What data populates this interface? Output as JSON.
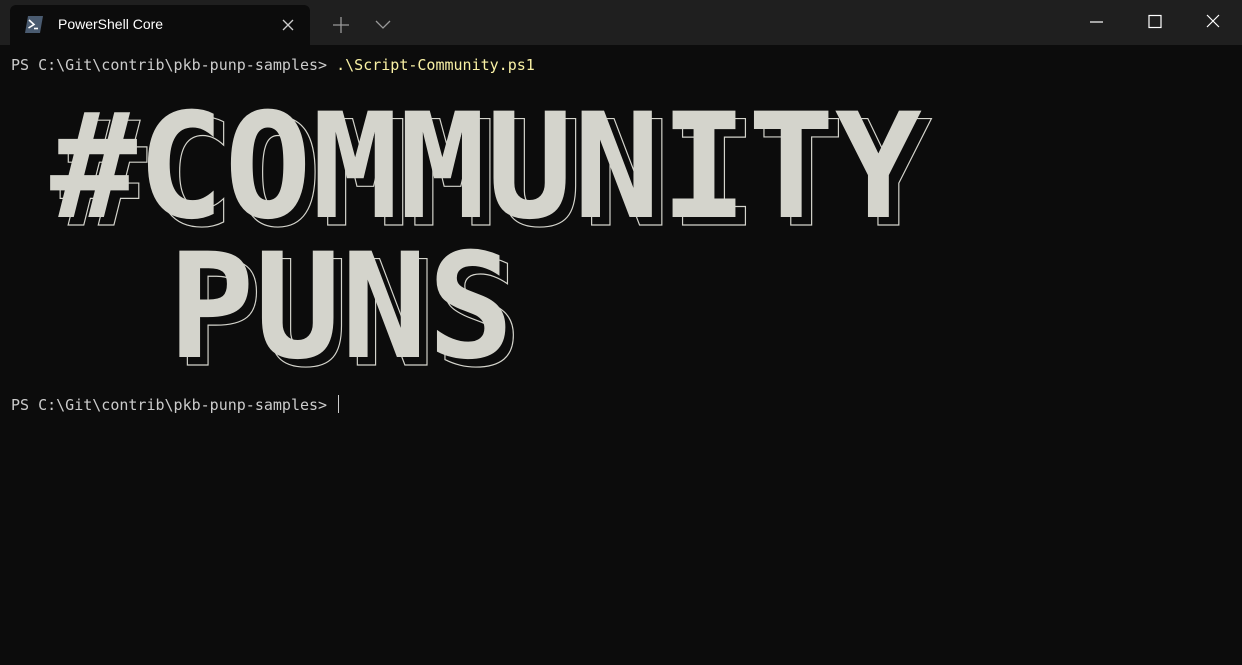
{
  "window": {
    "tab_title": "PowerShell Core",
    "icons": {
      "tab": "powershell-icon",
      "close_tab": "close-icon",
      "new_tab": "plus-icon",
      "dropdown": "chevron-down-icon",
      "minimize": "minimize-icon",
      "maximize": "maximize-icon",
      "close": "close-icon"
    }
  },
  "terminal": {
    "prompt1": "PS C:\\Git\\contrib\\pkb-punp-samples> ",
    "command1": ".\\Script-Community.ps1",
    "banner_line1": "#COMMUNITY",
    "banner_line2": "PUNS",
    "prompt2": "PS C:\\Git\\contrib\\pkb-punp-samples> "
  },
  "colors": {
    "background": "#0c0c0c",
    "titlebar": "#1f1f1f",
    "text": "#cccccc",
    "command": "#f9f1a5",
    "banner": "#d4d4cc"
  }
}
